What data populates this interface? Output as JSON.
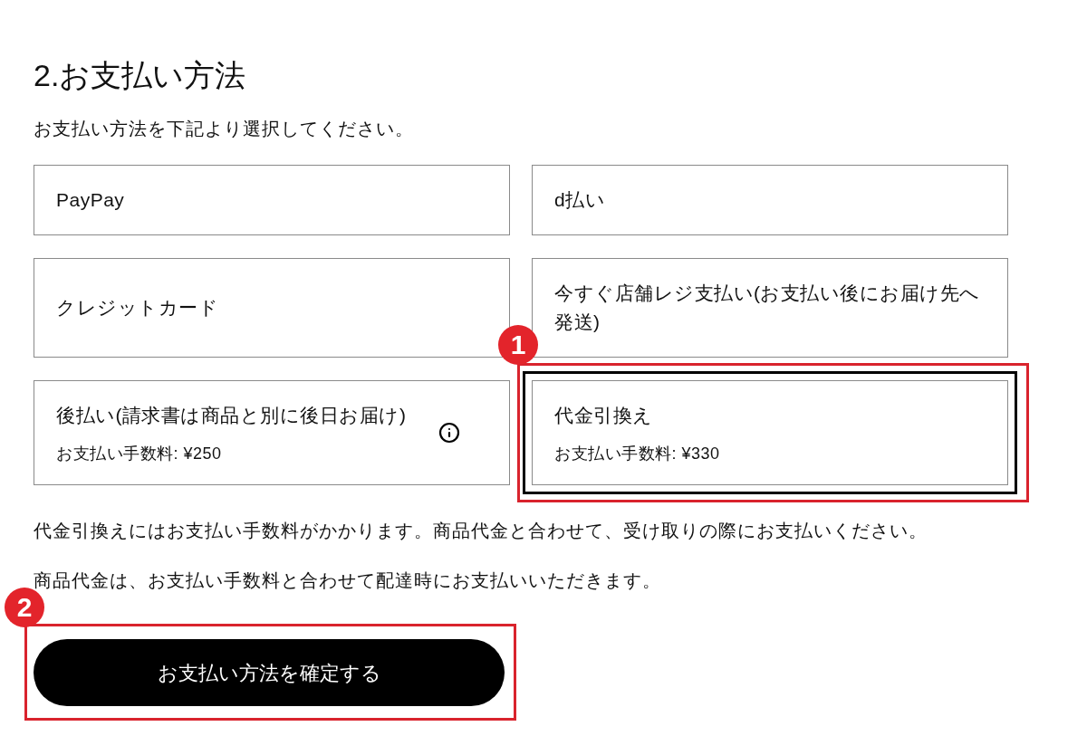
{
  "section": {
    "title": "2.お支払い方法",
    "instruction": "お支払い方法を下記より選択してください。"
  },
  "payment_options": [
    {
      "label": "PayPay",
      "info": false,
      "selected": false
    },
    {
      "label": "d払い",
      "info": false,
      "selected": false
    },
    {
      "label": "クレジットカード",
      "info": false,
      "selected": false
    },
    {
      "label": "今すぐ店舗レジ支払い(お支払い後にお届け先へ発送)",
      "info": false,
      "selected": false
    },
    {
      "label": "後払い(請求書は商品と別に後日お届け)",
      "fee": "お支払い手数料: ¥250",
      "info": true,
      "selected": false
    },
    {
      "label": "代金引換え",
      "fee": "お支払い手数料: ¥330",
      "info": false,
      "selected": true,
      "callout": "1"
    }
  ],
  "notes": [
    "代金引換えにはお支払い手数料がかかります。商品代金と合わせて、受け取りの際にお支払いください。",
    "商品代金は、お支払い手数料と合わせて配達時にお支払いいただきます。"
  ],
  "confirm_button": {
    "label": "お支払い方法を確定する",
    "callout": "2"
  }
}
